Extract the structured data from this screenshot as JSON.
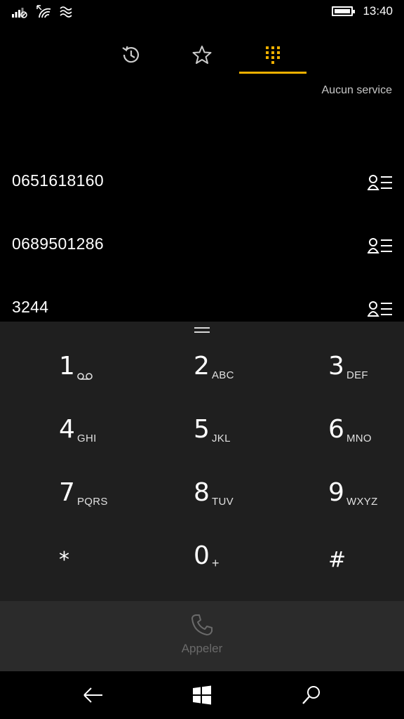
{
  "status": {
    "time": "13:40",
    "icons": [
      "signal-no-sim-icon",
      "wifi-icon",
      "cellular-data-icon",
      "battery-icon"
    ]
  },
  "tabs": [
    {
      "name": "history-icon",
      "selected": false
    },
    {
      "name": "favorites-star-icon",
      "selected": false
    },
    {
      "name": "keypad-icon",
      "selected": true
    }
  ],
  "colors": {
    "accent": "#f0b000",
    "keypad_bg": "#1f1f1f",
    "call_bar_bg": "#2b2b2b"
  },
  "network_status": "Aucun service",
  "recents": [
    {
      "number": "0651618160",
      "action_icon": "contact-card-icon"
    },
    {
      "number": "0689501286",
      "action_icon": "contact-card-icon"
    },
    {
      "number": "3244",
      "action_icon": "contact-card-icon"
    }
  ],
  "keypad": {
    "k1": {
      "digit": "1",
      "letters": ""
    },
    "k2": {
      "digit": "2",
      "letters": "ABC"
    },
    "k3": {
      "digit": "3",
      "letters": "DEF"
    },
    "k4": {
      "digit": "4",
      "letters": "GHI"
    },
    "k5": {
      "digit": "5",
      "letters": "JKL"
    },
    "k6": {
      "digit": "6",
      "letters": "MNO"
    },
    "k7": {
      "digit": "7",
      "letters": "PQRS"
    },
    "k8": {
      "digit": "8",
      "letters": "TUV"
    },
    "k9": {
      "digit": "9",
      "letters": "WXYZ"
    },
    "kstar": {
      "digit": "*"
    },
    "k0": {
      "digit": "0",
      "letters": "+"
    },
    "khash": {
      "digit": "#"
    }
  },
  "call_button": {
    "label": "Appeler"
  },
  "nav": [
    "back-arrow-icon",
    "windows-start-icon",
    "search-icon"
  ]
}
